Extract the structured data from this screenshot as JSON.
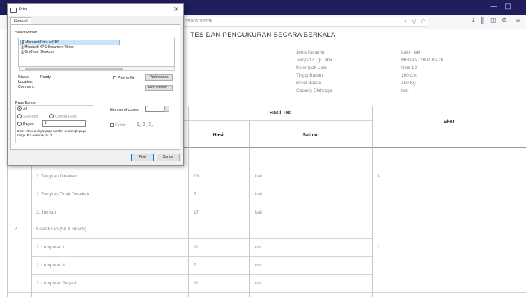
{
  "dialog": {
    "title": "Print",
    "tab": "General",
    "select_printer_label": "Select Printer",
    "printers": [
      "Microsoft Print to PDF",
      "Microsoft XPS Document Writer",
      "OneNote (Desktop)"
    ],
    "status_label": "Status:",
    "status_value": "Ready",
    "location_label": "Location:",
    "location_value": "",
    "comment_label": "Comment:",
    "comment_value": "",
    "print_to_file": "Print to file",
    "preferences_button": "Preferences",
    "find_printer_button": "Find Printer...",
    "page_range_label": "Page Range",
    "range_all": "All",
    "range_selection": "Selection",
    "range_current": "Current Page",
    "range_pages": "Pages:",
    "pages_value": "1",
    "range_hint": "Enter either a single page number or a single page range.  For example, 5-12",
    "copies_label": "Number of copies:",
    "copies_value": "1",
    "collate_label": "Collate",
    "print_button": "Print",
    "cancel_button": "Cancel"
  },
  "report": {
    "title": "TES DAN PENGUKURAN SECARA BERKALA",
    "info_labels": [
      "Jenis Kelamin",
      "Tempat / Tgl Lahir",
      "Kelompok Usia",
      "Tinggi Badan",
      "Berat Badan",
      "Cabang Olahraga"
    ],
    "info_values": [
      "Laki - laki",
      "MEDAN, 2002-05-26",
      "Usia 13",
      "160 Cm",
      "150 Kg",
      "test"
    ]
  },
  "table": {
    "header_hasil_tes": "Hasil Tes",
    "header_hasil": "Hasil",
    "header_satuan": "Satuan",
    "header_skor": "Skor",
    "group2_no": "2",
    "group2_name": "Kelenturan (Sit & Reach)",
    "rows": [
      {
        "name": "1. Tangkap Dinaikan",
        "hasil": "13",
        "satuan": "kali",
        "skor": "3"
      },
      {
        "name": "2. Tangkap Tidak Dinaikan",
        "hasil": "5",
        "satuan": "kali",
        "skor": ""
      },
      {
        "name": "3. Jumlah",
        "hasil": "17",
        "satuan": "kali",
        "skor": ""
      },
      {
        "name": "1. Lemparan I",
        "hasil": "11",
        "satuan": "cm",
        "skor": "1"
      },
      {
        "name": "2. Lemparan II",
        "hasil": "7",
        "satuan": "cm",
        "skor": ""
      },
      {
        "name": "3. Lemparan Terjauh",
        "hasil": "11",
        "satuan": "cm",
        "skor": ""
      }
    ]
  }
}
